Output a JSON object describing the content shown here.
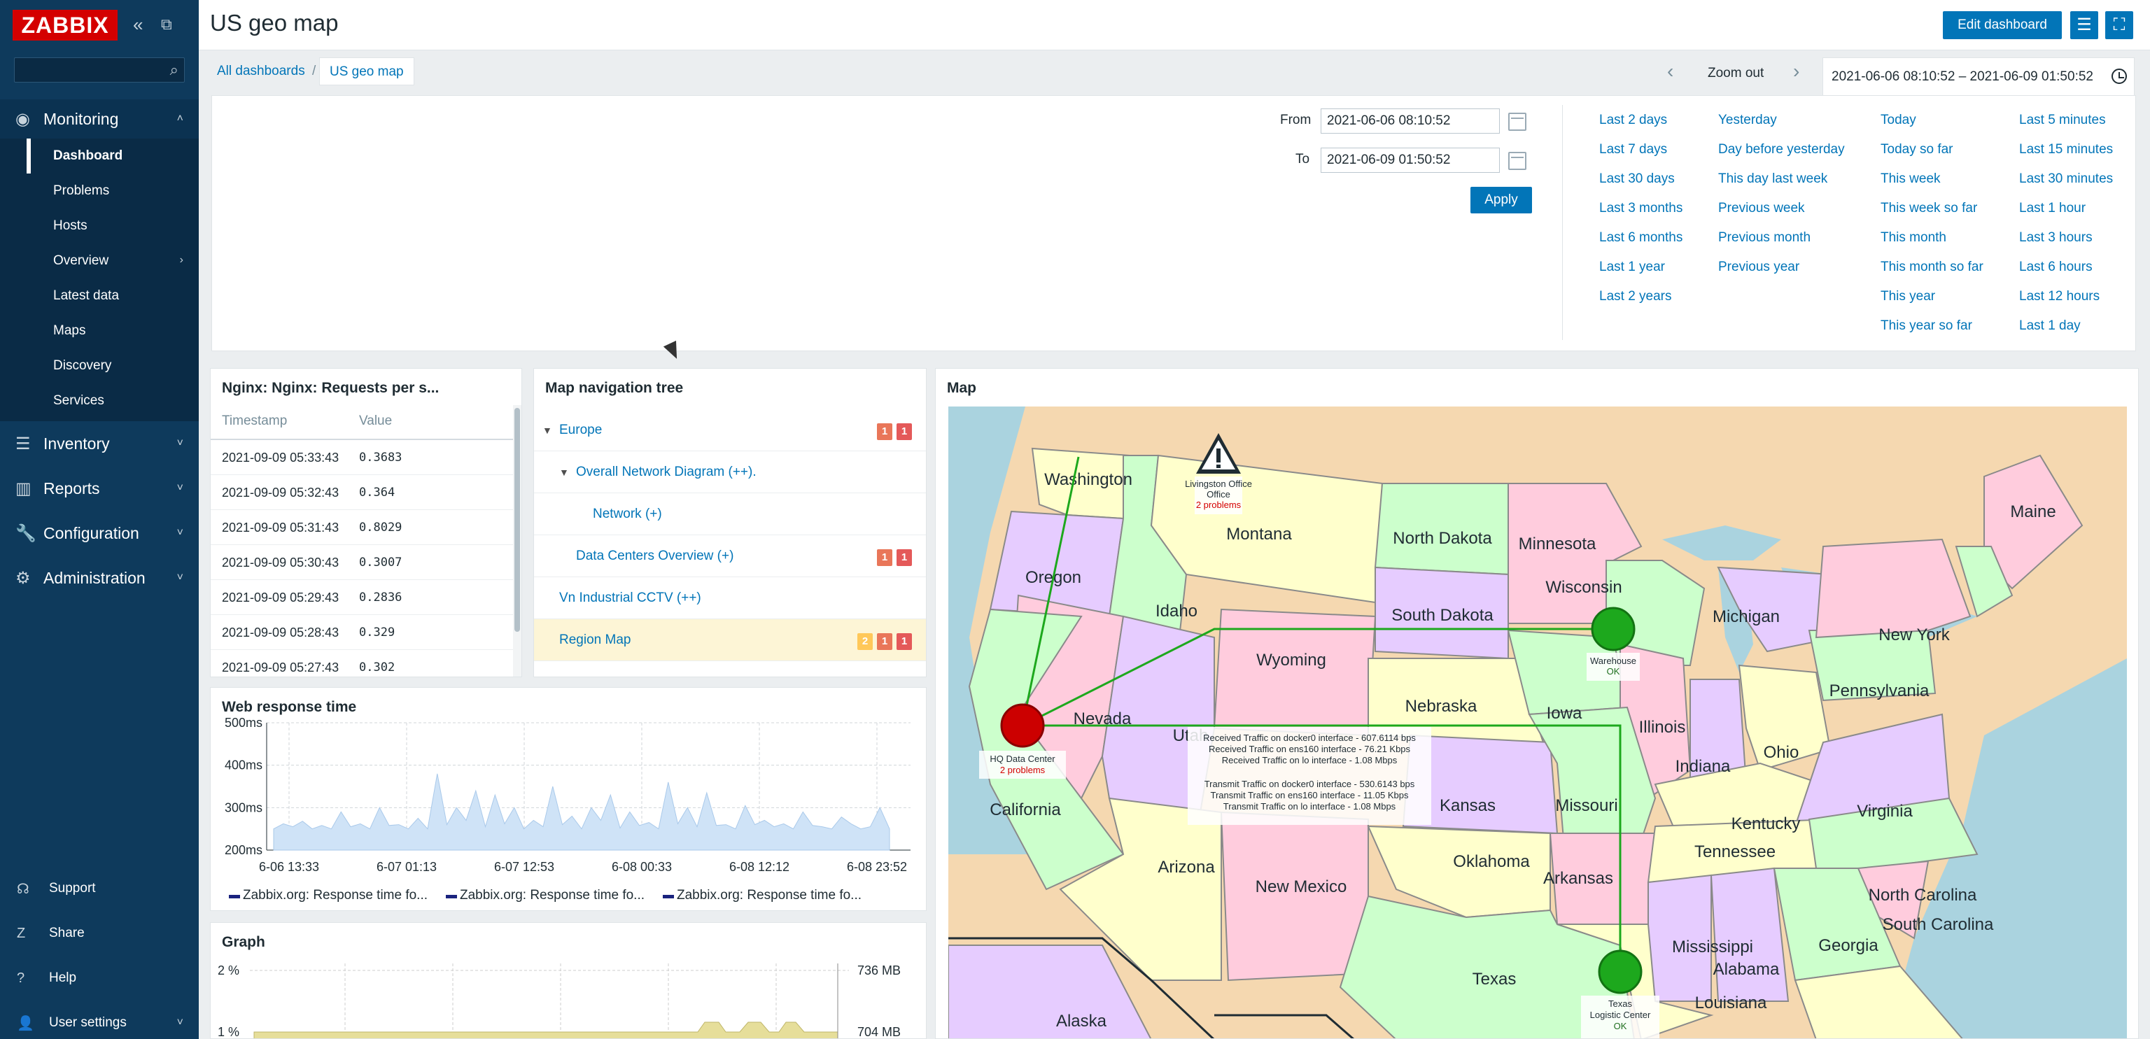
{
  "app": {
    "logo": "ZABBIX"
  },
  "sidebar": {
    "search_placeholder": "",
    "monitoring": {
      "label": "Monitoring",
      "items": [
        "Dashboard",
        "Problems",
        "Hosts",
        "Overview",
        "Latest data",
        "Maps",
        "Discovery",
        "Services"
      ]
    },
    "sections": [
      "Inventory",
      "Reports",
      "Configuration",
      "Administration"
    ],
    "bottom": [
      "Support",
      "Share",
      "Help",
      "User settings"
    ]
  },
  "header": {
    "title": "US geo map",
    "edit_button": "Edit dashboard",
    "breadcrumb": [
      "All dashboards",
      "US geo map"
    ],
    "zoom_out": "Zoom out",
    "period": "2021-06-06 08:10:52 – 2021-06-09 01:50:52"
  },
  "filter": {
    "from_label": "From",
    "from_value": "2021-06-06 08:10:52",
    "to_label": "To",
    "to_value": "2021-06-09 01:50:52",
    "apply": "Apply",
    "columns": [
      [
        "Last 2 days",
        "Last 7 days",
        "Last 30 days",
        "Last 3 months",
        "Last 6 months",
        "Last 1 year",
        "Last 2 years"
      ],
      [
        "Yesterday",
        "Day before yesterday",
        "This day last week",
        "Previous week",
        "Previous month",
        "Previous year"
      ],
      [
        "Today",
        "Today so far",
        "This week",
        "This week so far",
        "This month",
        "This month so far",
        "This year",
        "This year so far"
      ],
      [
        "Last 5 minutes",
        "Last 15 minutes",
        "Last 30 minutes",
        "Last 1 hour",
        "Last 3 hours",
        "Last 6 hours",
        "Last 12 hours",
        "Last 1 day"
      ]
    ]
  },
  "nginx_widget": {
    "title": "Nginx: Nginx: Requests per s...",
    "headers": [
      "Timestamp",
      "Value"
    ],
    "rows": [
      [
        "2021-09-09 05:33:43",
        "0.3683"
      ],
      [
        "2021-09-09 05:32:43",
        "0.364"
      ],
      [
        "2021-09-09 05:31:43",
        "0.8029"
      ],
      [
        "2021-09-09 05:30:43",
        "0.3007"
      ],
      [
        "2021-09-09 05:29:43",
        "0.2836"
      ],
      [
        "2021-09-09 05:28:43",
        "0.329"
      ],
      [
        "2021-09-09 05:27:43",
        "0.302"
      ]
    ]
  },
  "nav_tree": {
    "title": "Map navigation tree",
    "items": [
      {
        "label": "Europe",
        "badges": [
          "1",
          "1"
        ]
      },
      {
        "label": "Overall Network Diagram (++).",
        "badges": []
      },
      {
        "label": "Network (+)",
        "badges": []
      },
      {
        "label": "Data Centers Overview (+)",
        "badges": [
          "1",
          "1"
        ]
      },
      {
        "label": "Vn Industrial CCTV (++)",
        "badges": []
      },
      {
        "label": "Region Map",
        "badges": [
          "2",
          "1",
          "1"
        ]
      }
    ]
  },
  "web_response": {
    "title": "Web response time",
    "legend": [
      "Zabbix.org: Response time fo...",
      "Zabbix.org: Response time fo...",
      "Zabbix.org: Response time fo..."
    ]
  },
  "graph_widget": {
    "title": "Graph",
    "y_left_top": "2 %",
    "y_left_bottom": "1 %",
    "y_right_top": "736 MB",
    "y_right_bottom": "704 MB"
  },
  "map": {
    "title": "Map",
    "states": [
      "Washington",
      "Oregon",
      "Idaho",
      "Montana",
      "North Dakota",
      "Minnesota",
      "South Dakota",
      "Wisconsin",
      "Wyoming",
      "Michigan",
      "Nevada",
      "Utah",
      "California",
      "Nebraska",
      "Iowa",
      "Illinois",
      "Indiana",
      "Ohio",
      "Pennsylvania",
      "New York",
      "Maine",
      "Kansas",
      "Missouri",
      "Kentucky",
      "Virginia",
      "Arizona",
      "New Mexico",
      "Oklahoma",
      "Arkansas",
      "Tennessee",
      "North Carolina",
      "South Carolina",
      "Mississippi",
      "Alabama",
      "Georgia",
      "Texas",
      "Louisiana",
      "Alaska"
    ],
    "hosts": [
      {
        "name": "Livingston Office",
        "line2": "Office",
        "status": "2 problems"
      },
      {
        "name": "HQ Data Center",
        "status": "2 problems"
      },
      {
        "name": "Warehouse",
        "status": "OK"
      },
      {
        "name": "Texas Logistic Center",
        "line1": "Texas",
        "line2": "Logistic Center",
        "status": "OK"
      }
    ],
    "traffic": [
      "Received Traffic on docker0 interface - 607.6114 bps",
      "Received Traffic on ens160 interface - 76.21 Kbps",
      "Received Traffic on lo interface - 1.08 Mbps",
      "Transmit Traffic on docker0 interface - 530.6143 bps",
      "Transmit Traffic on ens160 interface - 11.05 Kbps",
      "Transmit Traffic on lo interface - 1.08 Mbps"
    ]
  },
  "chart_data": {
    "type": "area",
    "title": "Web response time",
    "x_ticks": [
      "6-06 13:33",
      "6-07 01:13",
      "6-07 12:53",
      "6-08 00:33",
      "6-08 12:12",
      "6-08 23:52"
    ],
    "y_ticks": [
      "500ms",
      "400ms",
      "300ms",
      "200ms"
    ],
    "ylim": [
      200,
      500
    ],
    "series": [
      {
        "name": "Zabbix.org: Response time fo...",
        "values": [
          250,
          262,
          255,
          268,
          250,
          258,
          250,
          290,
          255,
          262,
          250,
          300,
          258,
          260,
          250,
          275,
          250,
          380,
          260,
          300,
          270,
          340,
          255,
          330,
          262,
          300,
          250,
          270,
          255,
          350,
          260,
          280,
          250,
          300,
          270,
          330,
          252,
          290,
          258,
          265,
          250,
          360,
          262,
          300,
          255,
          335,
          258,
          260,
          250,
          305,
          260,
          270,
          255,
          262,
          250,
          290,
          258,
          255,
          250,
          278,
          262,
          250,
          255,
          300,
          250
        ]
      }
    ]
  }
}
